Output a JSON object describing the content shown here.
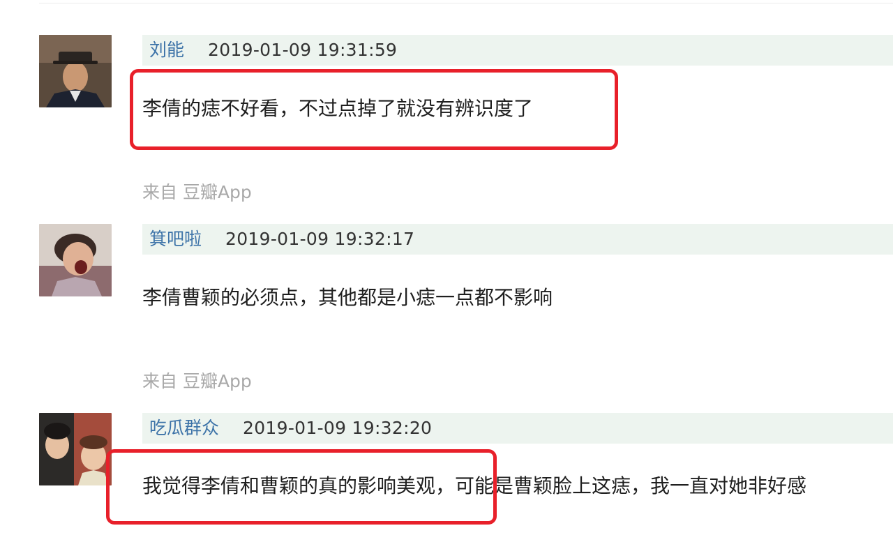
{
  "comments": [
    {
      "username": "刘能",
      "timestamp": "2019-01-09 19:31:59",
      "text": "李倩的痣不好看，不过点掉了就没有辨识度了",
      "source": "来自 豆瓣App",
      "highlighted": true
    },
    {
      "username": "箕吧啦",
      "timestamp": "2019-01-09 19:32:17",
      "text": "李倩曹颖的必须点，其他都是小痣一点都不影响",
      "source": "来自 豆瓣App",
      "highlighted": false
    },
    {
      "username": "吃瓜群众",
      "timestamp": "2019-01-09 19:32:20",
      "text": "我觉得李倩和曹颖的真的影响美观，可能是曹颖脸上这痣，我一直对她非好感",
      "highlighted": true
    }
  ],
  "colors": {
    "username": "#3d73a8",
    "meta_bar_bg": "#edf4ef",
    "highlight_border": "#e8202a",
    "source_text": "#a8a8a8"
  }
}
